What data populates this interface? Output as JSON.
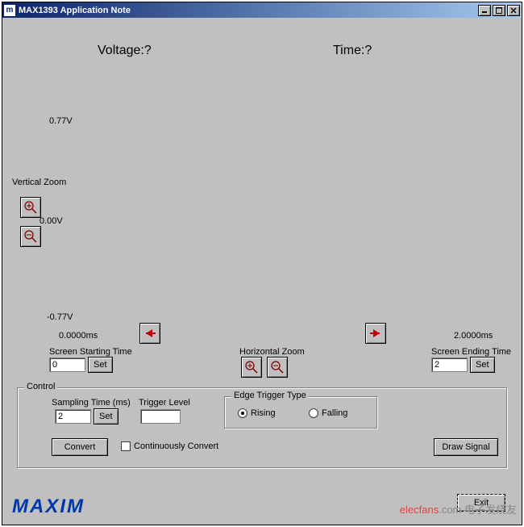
{
  "window": {
    "title": "MAX1393 Application Note",
    "icon_symbol": "m"
  },
  "readout": {
    "voltage_label": "Voltage:?",
    "time_label": "Time:?"
  },
  "scale": {
    "top": "0.77V",
    "mid": "0.00V",
    "bot": "-0.77V"
  },
  "vzoom": {
    "label": "Vertical Zoom"
  },
  "hzoom": {
    "label": "Horizontal Zoom"
  },
  "timeaxis": {
    "start_val": "0.0000ms",
    "end_val": "2.0000ms",
    "start_label": "Screen Starting Time",
    "end_label": "Screen Ending Time",
    "start_input": "0",
    "end_input": "2",
    "set_btn": "Set"
  },
  "control": {
    "legend": "Control",
    "sampling_label": "Sampling Time (ms)",
    "sampling_value": "2",
    "set_btn": "Set",
    "trigger_label": "Trigger Level",
    "trigger_value": "",
    "edge_legend": "Edge Trigger Type",
    "rising_label": "Rising",
    "falling_label": "Falling",
    "convert_btn": "Convert",
    "continuous_label": "Continuously Convert",
    "draw_btn": "Draw Signal"
  },
  "footer": {
    "logo_text": "MAXIM",
    "exit_btn": "Exit",
    "watermark_red": "elecfans",
    "watermark_suffix": ".com 电子发烧友"
  }
}
